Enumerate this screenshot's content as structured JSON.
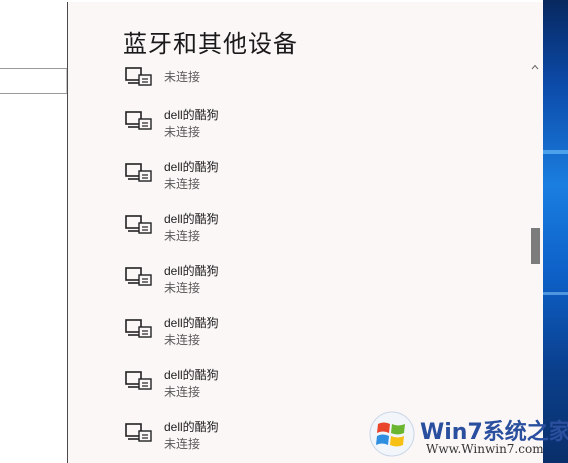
{
  "panel": {
    "title": "蓝牙和其他设备"
  },
  "devices": [
    {
      "name": "",
      "status": "未连接"
    },
    {
      "name": "dell的酷狗",
      "status": "未连接"
    },
    {
      "name": "dell的酷狗",
      "status": "未连接"
    },
    {
      "name": "dell的酷狗",
      "status": "未连接"
    },
    {
      "name": "dell的酷狗",
      "status": "未连接"
    },
    {
      "name": "dell的酷狗",
      "status": "未连接"
    },
    {
      "name": "dell的酷狗",
      "status": "未连接"
    },
    {
      "name": "dell的酷狗",
      "status": "未连接"
    }
  ],
  "icons": {
    "device": "media-device-icon",
    "search": "search-icon",
    "scroll_up": "chevron-up-icon"
  },
  "watermark": {
    "brand": "Win7系统之家",
    "url": "Www.Winwin7.com"
  },
  "colors": {
    "panel_bg": "#fcf7f7",
    "watermark_blue": "#2a4f9e",
    "watermark_orange": "#e0491b"
  }
}
